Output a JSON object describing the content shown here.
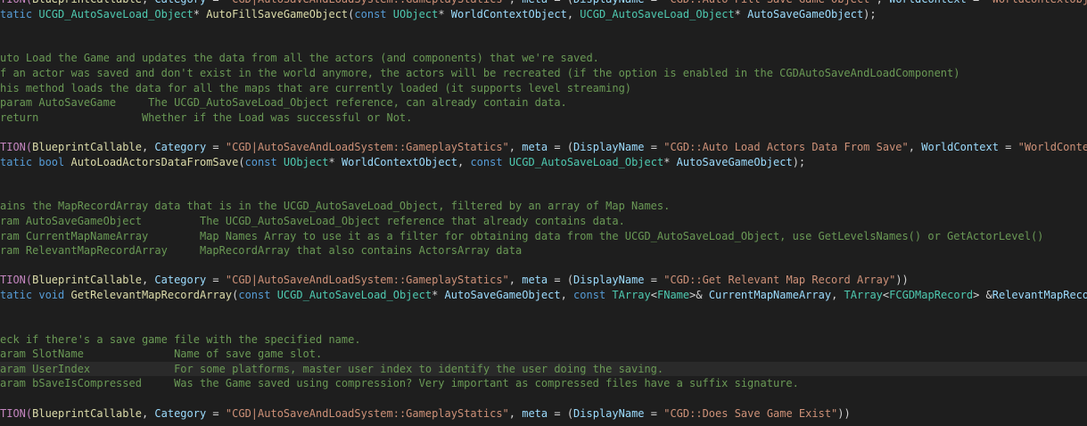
{
  "colors": {
    "background": "#1e1e1e",
    "current_line": "#2a2a2a",
    "comment": "#6a9955",
    "keyword": "#569cd6",
    "macro": "#c586c0",
    "type": "#4ec9b0",
    "function": "#dcdcaa",
    "string": "#ce9178",
    "identifier": "#9cdcfe",
    "text": "#d4d4d4"
  },
  "lines": [
    {
      "tokens": [
        {
          "k": "macro",
          "t": "TION("
        },
        {
          "k": "fn",
          "t": "BlueprintCallable"
        },
        {
          "k": "op",
          "t": ", "
        },
        {
          "k": "ident",
          "t": "Category"
        },
        {
          "k": "op",
          "t": " = "
        },
        {
          "k": "str",
          "t": "\"CGD|AutoSaveAndLoadSystem::GameplayStatics\""
        },
        {
          "k": "op",
          "t": ", "
        },
        {
          "k": "ident",
          "t": "meta"
        },
        {
          "k": "op",
          "t": " = ("
        },
        {
          "k": "ident",
          "t": "DisplayName"
        },
        {
          "k": "op",
          "t": " = "
        },
        {
          "k": "str",
          "t": "\"CGD::Auto Fill Save Game Object\""
        },
        {
          "k": "op",
          "t": ", "
        },
        {
          "k": "ident",
          "t": "WorldContext"
        },
        {
          "k": "op",
          "t": " = "
        },
        {
          "k": "str",
          "t": "\"WorldContextObject\""
        },
        {
          "k": "op",
          "t": ")"
        }
      ]
    },
    {
      "tokens": [
        {
          "k": "kw",
          "t": "tatic "
        },
        {
          "k": "type",
          "t": "UCGD_AutoSaveLoad_Object"
        },
        {
          "k": "op",
          "t": "* "
        },
        {
          "k": "fnname",
          "t": "AutoFillSaveGameObject"
        },
        {
          "k": "op",
          "t": "("
        },
        {
          "k": "kw",
          "t": "const "
        },
        {
          "k": "type",
          "t": "UObject"
        },
        {
          "k": "op",
          "t": "* "
        },
        {
          "k": "param",
          "t": "WorldContextObject"
        },
        {
          "k": "op",
          "t": ", "
        },
        {
          "k": "type",
          "t": "UCGD_AutoSaveLoad_Object"
        },
        {
          "k": "op",
          "t": "* "
        },
        {
          "k": "param",
          "t": "AutoSaveGameObject"
        },
        {
          "k": "op",
          "t": ");"
        }
      ]
    },
    {
      "tokens": []
    },
    {
      "tokens": []
    },
    {
      "tokens": [
        {
          "k": "cmt",
          "t": "uto Load the Game and updates the data from all the actors (and components) that we're saved."
        }
      ]
    },
    {
      "tokens": [
        {
          "k": "cmt",
          "t": "f an actor was saved and don't exist in the world anymore, the actors will be recreated (if the option is enabled in the CGDAutoSaveAndLoadComponent)"
        }
      ]
    },
    {
      "tokens": [
        {
          "k": "cmt",
          "t": "his method loads the data for all the maps that are currently loaded (it supports level streaming)"
        }
      ]
    },
    {
      "tokens": [
        {
          "k": "cmt",
          "t": "param AutoSaveGame     The UCGD_AutoSaveLoad_Object reference, can already contain data."
        }
      ]
    },
    {
      "tokens": [
        {
          "k": "cmt",
          "t": "return                Whether if the Load was successful or Not."
        }
      ]
    },
    {
      "tokens": []
    },
    {
      "tokens": [
        {
          "k": "macro",
          "t": "TION("
        },
        {
          "k": "fn",
          "t": "BlueprintCallable"
        },
        {
          "k": "op",
          "t": ", "
        },
        {
          "k": "ident",
          "t": "Category"
        },
        {
          "k": "op",
          "t": " = "
        },
        {
          "k": "str",
          "t": "\"CGD|AutoSaveAndLoadSystem::GameplayStatics\""
        },
        {
          "k": "op",
          "t": ", "
        },
        {
          "k": "ident",
          "t": "meta"
        },
        {
          "k": "op",
          "t": " = ("
        },
        {
          "k": "ident",
          "t": "DisplayName"
        },
        {
          "k": "op",
          "t": " = "
        },
        {
          "k": "str",
          "t": "\"CGD::Auto Load Actors Data From Save\""
        },
        {
          "k": "op",
          "t": ", "
        },
        {
          "k": "ident",
          "t": "WorldContext"
        },
        {
          "k": "op",
          "t": " = "
        },
        {
          "k": "str",
          "t": "\"WorldContextObj"
        }
      ]
    },
    {
      "tokens": [
        {
          "k": "kw",
          "t": "tatic bool "
        },
        {
          "k": "fnname",
          "t": "AutoLoadActorsDataFromSave"
        },
        {
          "k": "op",
          "t": "("
        },
        {
          "k": "kw",
          "t": "const "
        },
        {
          "k": "type",
          "t": "UObject"
        },
        {
          "k": "op",
          "t": "* "
        },
        {
          "k": "param",
          "t": "WorldContextObject"
        },
        {
          "k": "op",
          "t": ", "
        },
        {
          "k": "kw",
          "t": "const "
        },
        {
          "k": "type",
          "t": "UCGD_AutoSaveLoad_Object"
        },
        {
          "k": "op",
          "t": "* "
        },
        {
          "k": "param",
          "t": "AutoSaveGameObject"
        },
        {
          "k": "op",
          "t": ");"
        }
      ]
    },
    {
      "tokens": []
    },
    {
      "tokens": []
    },
    {
      "tokens": [
        {
          "k": "cmt",
          "t": "ains the MapRecordArray data that is in the UCGD_AutoSaveLoad_Object, filtered by an array of Map Names."
        }
      ]
    },
    {
      "tokens": [
        {
          "k": "cmt",
          "t": "ram AutoSaveGameObject         The UCGD_AutoSaveLoad_Object reference that already contains data."
        }
      ]
    },
    {
      "tokens": [
        {
          "k": "cmt",
          "t": "ram CurrentMapNameArray        Map Names Array to use it as a filter for obtaining data from the UCGD_AutoSaveLoad_Object, use GetLevelsNames() or GetActorLevel()"
        }
      ]
    },
    {
      "tokens": [
        {
          "k": "cmt",
          "t": "ram RelevantMapRecordArray     MapRecordArray that also contains ActorsArray data"
        }
      ]
    },
    {
      "tokens": []
    },
    {
      "tokens": [
        {
          "k": "macro",
          "t": "TION("
        },
        {
          "k": "fn",
          "t": "BlueprintCallable"
        },
        {
          "k": "op",
          "t": ", "
        },
        {
          "k": "ident",
          "t": "Category"
        },
        {
          "k": "op",
          "t": " = "
        },
        {
          "k": "str",
          "t": "\"CGD|AutoSaveAndLoadSystem::GameplayStatics\""
        },
        {
          "k": "op",
          "t": ", "
        },
        {
          "k": "ident",
          "t": "meta"
        },
        {
          "k": "op",
          "t": " = ("
        },
        {
          "k": "ident",
          "t": "DisplayName"
        },
        {
          "k": "op",
          "t": " = "
        },
        {
          "k": "str",
          "t": "\"CGD::Get Relevant Map Record Array\""
        },
        {
          "k": "op",
          "t": "))"
        }
      ]
    },
    {
      "tokens": [
        {
          "k": "kw",
          "t": "tatic void "
        },
        {
          "k": "fnname",
          "t": "GetRelevantMapRecordArray"
        },
        {
          "k": "op",
          "t": "("
        },
        {
          "k": "kw",
          "t": "const "
        },
        {
          "k": "type",
          "t": "UCGD_AutoSaveLoad_Object"
        },
        {
          "k": "op",
          "t": "* "
        },
        {
          "k": "param",
          "t": "AutoSaveGameObject"
        },
        {
          "k": "op",
          "t": ", "
        },
        {
          "k": "kw",
          "t": "const "
        },
        {
          "k": "type",
          "t": "TArray"
        },
        {
          "k": "op",
          "t": "<"
        },
        {
          "k": "type",
          "t": "FName"
        },
        {
          "k": "op",
          "t": ">& "
        },
        {
          "k": "param",
          "t": "CurrentMapNameArray"
        },
        {
          "k": "op",
          "t": ", "
        },
        {
          "k": "type",
          "t": "TArray"
        },
        {
          "k": "op",
          "t": "<"
        },
        {
          "k": "type",
          "t": "FCGDMapRecord"
        },
        {
          "k": "op",
          "t": "> &"
        },
        {
          "k": "param",
          "t": "RelevantMapRecordArr"
        }
      ]
    },
    {
      "tokens": []
    },
    {
      "tokens": []
    },
    {
      "tokens": [
        {
          "k": "cmt",
          "t": "eck if there's a save game file with the specified name."
        }
      ]
    },
    {
      "tokens": [
        {
          "k": "cmt",
          "t": "aram SlotName              Name of save game slot."
        }
      ]
    },
    {
      "hl": true,
      "tokens": [
        {
          "k": "cmt",
          "t": "aram UserIndex             For some platforms, master user index to identify the user doing the saving."
        }
      ]
    },
    {
      "tokens": [
        {
          "k": "cmt",
          "t": "aram bSaveIsCompressed     Was the Game saved using compression? Very important as compressed files have a suffix signature."
        }
      ]
    },
    {
      "tokens": []
    },
    {
      "tokens": [
        {
          "k": "macro",
          "t": "TION("
        },
        {
          "k": "fn",
          "t": "BlueprintCallable"
        },
        {
          "k": "op",
          "t": ", "
        },
        {
          "k": "ident",
          "t": "Category"
        },
        {
          "k": "op",
          "t": " = "
        },
        {
          "k": "str",
          "t": "\"CGD|AutoSaveAndLoadSystem::GameplayStatics\""
        },
        {
          "k": "op",
          "t": ", "
        },
        {
          "k": "ident",
          "t": "meta"
        },
        {
          "k": "op",
          "t": " = ("
        },
        {
          "k": "ident",
          "t": "DisplayName"
        },
        {
          "k": "op",
          "t": " = "
        },
        {
          "k": "str",
          "t": "\"CGD::Does Save Game Exist\""
        },
        {
          "k": "op",
          "t": "))"
        }
      ]
    }
  ]
}
